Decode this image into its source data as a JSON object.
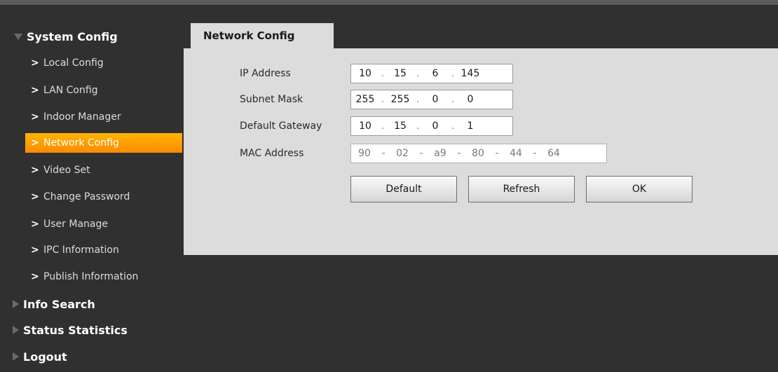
{
  "sidebar": {
    "system_config": "System Config",
    "items": [
      {
        "label": "Local Config"
      },
      {
        "label": "LAN Config"
      },
      {
        "label": "Indoor Manager"
      },
      {
        "label": "Network Config",
        "active": true
      },
      {
        "label": "Video Set"
      },
      {
        "label": "Change Password"
      },
      {
        "label": "User Manage"
      },
      {
        "label": "IPC Information"
      },
      {
        "label": "Publish Information"
      }
    ],
    "info_search": "Info Search",
    "status_statistics": "Status Statistics",
    "logout": "Logout",
    "chevron": ">"
  },
  "tab": {
    "title": "Network Config"
  },
  "form": {
    "ip": {
      "label": "IP Address",
      "octets": [
        "10",
        "15",
        "6",
        "145"
      ]
    },
    "subnet": {
      "label": "Subnet Mask",
      "octets": [
        "255",
        "255",
        "0",
        "0"
      ]
    },
    "gateway": {
      "label": "Default Gateway",
      "octets": [
        "10",
        "15",
        "0",
        "1"
      ]
    },
    "mac": {
      "label": "MAC Address",
      "parts": [
        "90",
        "02",
        "a9",
        "80",
        "44",
        "64"
      ]
    },
    "dot": ".",
    "dash": "-"
  },
  "buttons": {
    "default": "Default",
    "refresh": "Refresh",
    "ok": "OK"
  },
  "colors": {
    "accent": "#ff9900",
    "background": "#303030",
    "panel": "#dcdcdc"
  }
}
